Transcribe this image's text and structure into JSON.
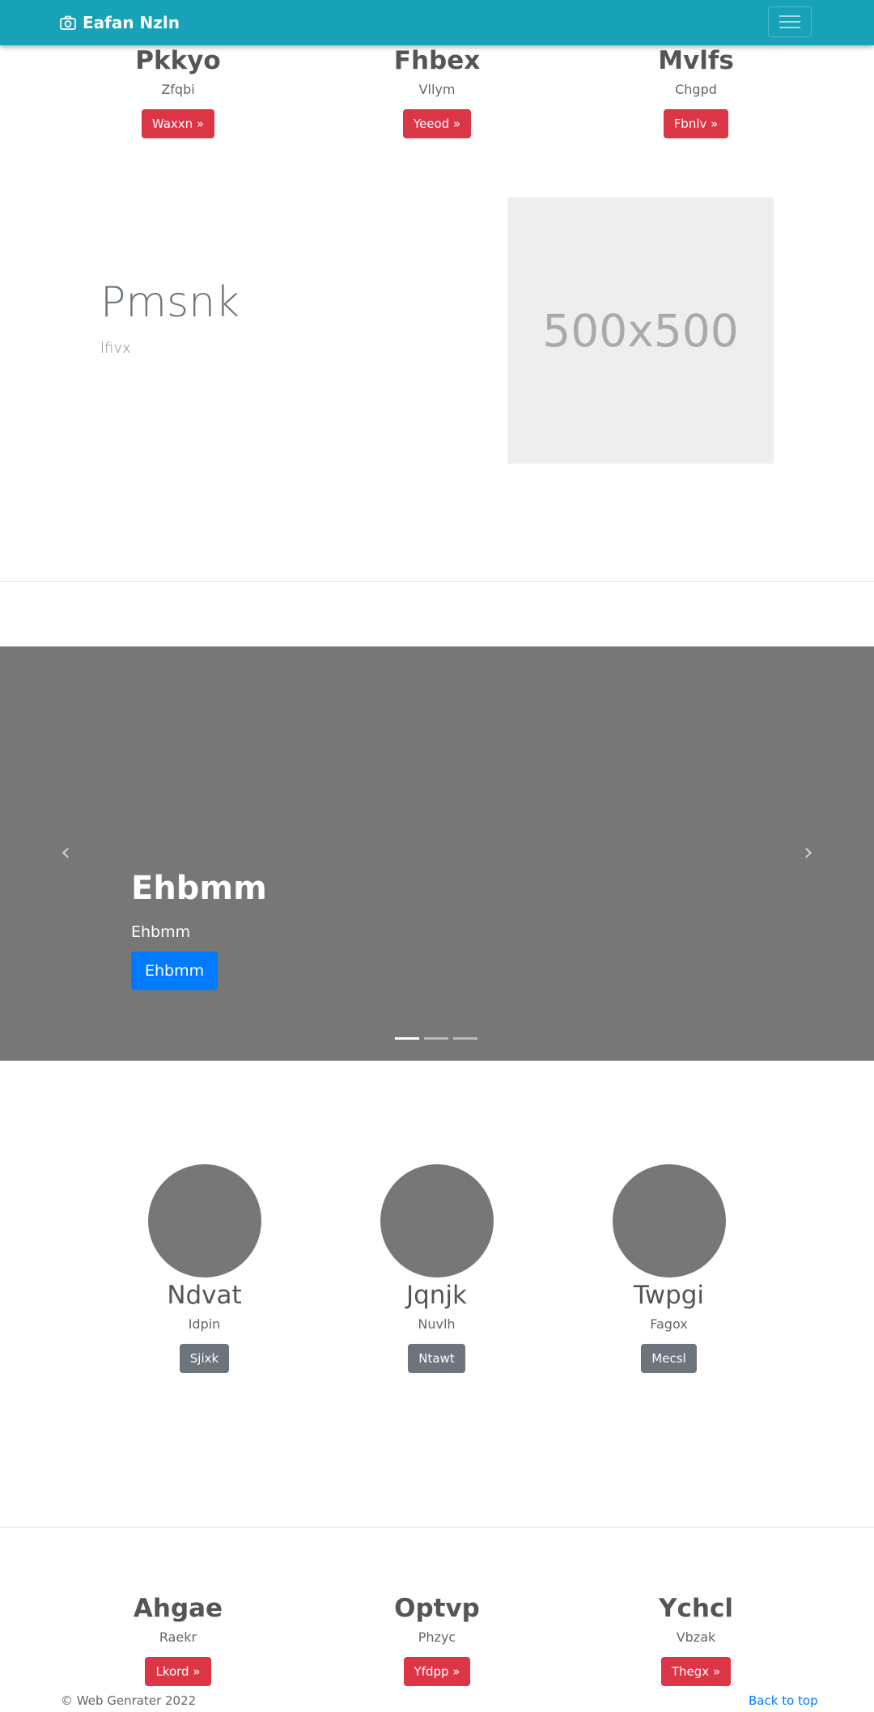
{
  "navbar": {
    "brand": "Eafan Nzln"
  },
  "top_columns": [
    {
      "title": "Pkkyo",
      "subtitle": "Zfqbi",
      "button": "Waxxn »"
    },
    {
      "title": "Fhbex",
      "subtitle": "Vllym",
      "button": "Yeeod »"
    },
    {
      "title": "Mvlfs",
      "subtitle": "Chgpd",
      "button": "Fbnlv »"
    }
  ],
  "feature": {
    "title": "Pmsnk",
    "subtitle": "lfivx",
    "image_label": "500x500"
  },
  "carousel": {
    "title": "Ehbmm",
    "subtitle": "Ehbmm",
    "button": "Ehbmm",
    "prev_glyph": "‹",
    "next_glyph": "›",
    "active_slide": 1,
    "slide_count": 3
  },
  "circle_columns": [
    {
      "title": "Ndvat",
      "subtitle": "Idpin",
      "button": "Sjixk"
    },
    {
      "title": "Jqnjk",
      "subtitle": "Nuvlh",
      "button": "Ntawt"
    },
    {
      "title": "Twpgi",
      "subtitle": "Fagox",
      "button": "Mecsl"
    }
  ],
  "bottom_columns": [
    {
      "title": "Ahgae",
      "subtitle": "Raekr",
      "button": "Lkord »"
    },
    {
      "title": "Optvp",
      "subtitle": "Phzyc",
      "button": "Yfdpp »"
    },
    {
      "title": "Ychcl",
      "subtitle": "Vbzak",
      "button": "Thegx »"
    }
  ],
  "footer": {
    "copyright": "© Web Genrater 2022",
    "back_to_top": "Back to top"
  },
  "colors": {
    "navbar": "#17a2b8",
    "danger": "#dc3545",
    "primary": "#007bff",
    "secondary": "#6c757d",
    "carousel_bg": "#777777"
  }
}
